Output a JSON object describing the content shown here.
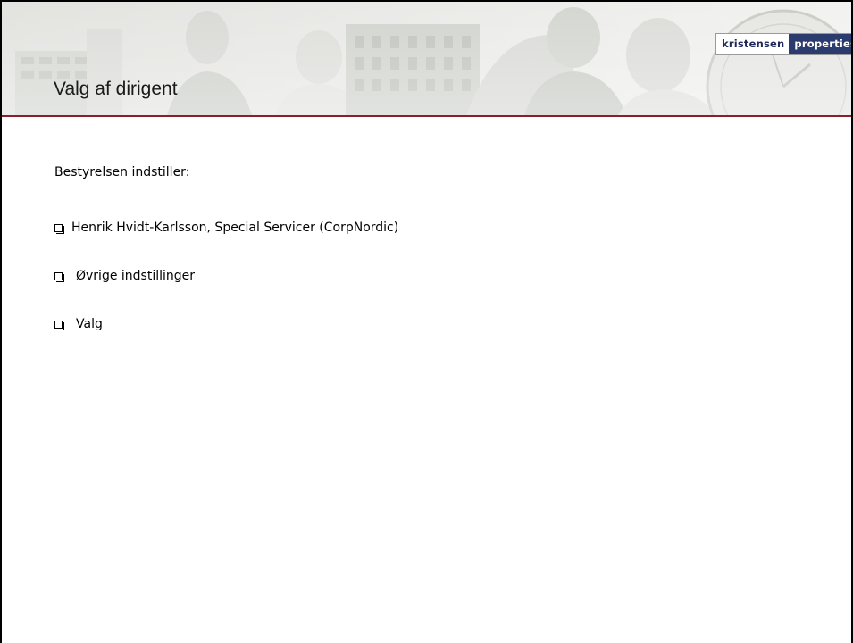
{
  "slide": {
    "title": "Valg af dirigent",
    "logo": {
      "left_text": "kristensen",
      "right_text": "properties",
      "colors": {
        "dark": "#2b3b6e",
        "text_dark": "#1f2a5a"
      }
    },
    "accent_color": "#8a1e2c",
    "intro": "Bestyrelsen indstiller:",
    "bullets": [
      {
        "label": "Henrik Hvidt-Karlsson, Special Servicer (CorpNordic)",
        "icon": "checkbox-icon"
      },
      {
        "label": "Øvrige indstillinger",
        "icon": "checkbox-icon"
      },
      {
        "label": "Valg",
        "icon": "checkbox-icon"
      }
    ]
  }
}
